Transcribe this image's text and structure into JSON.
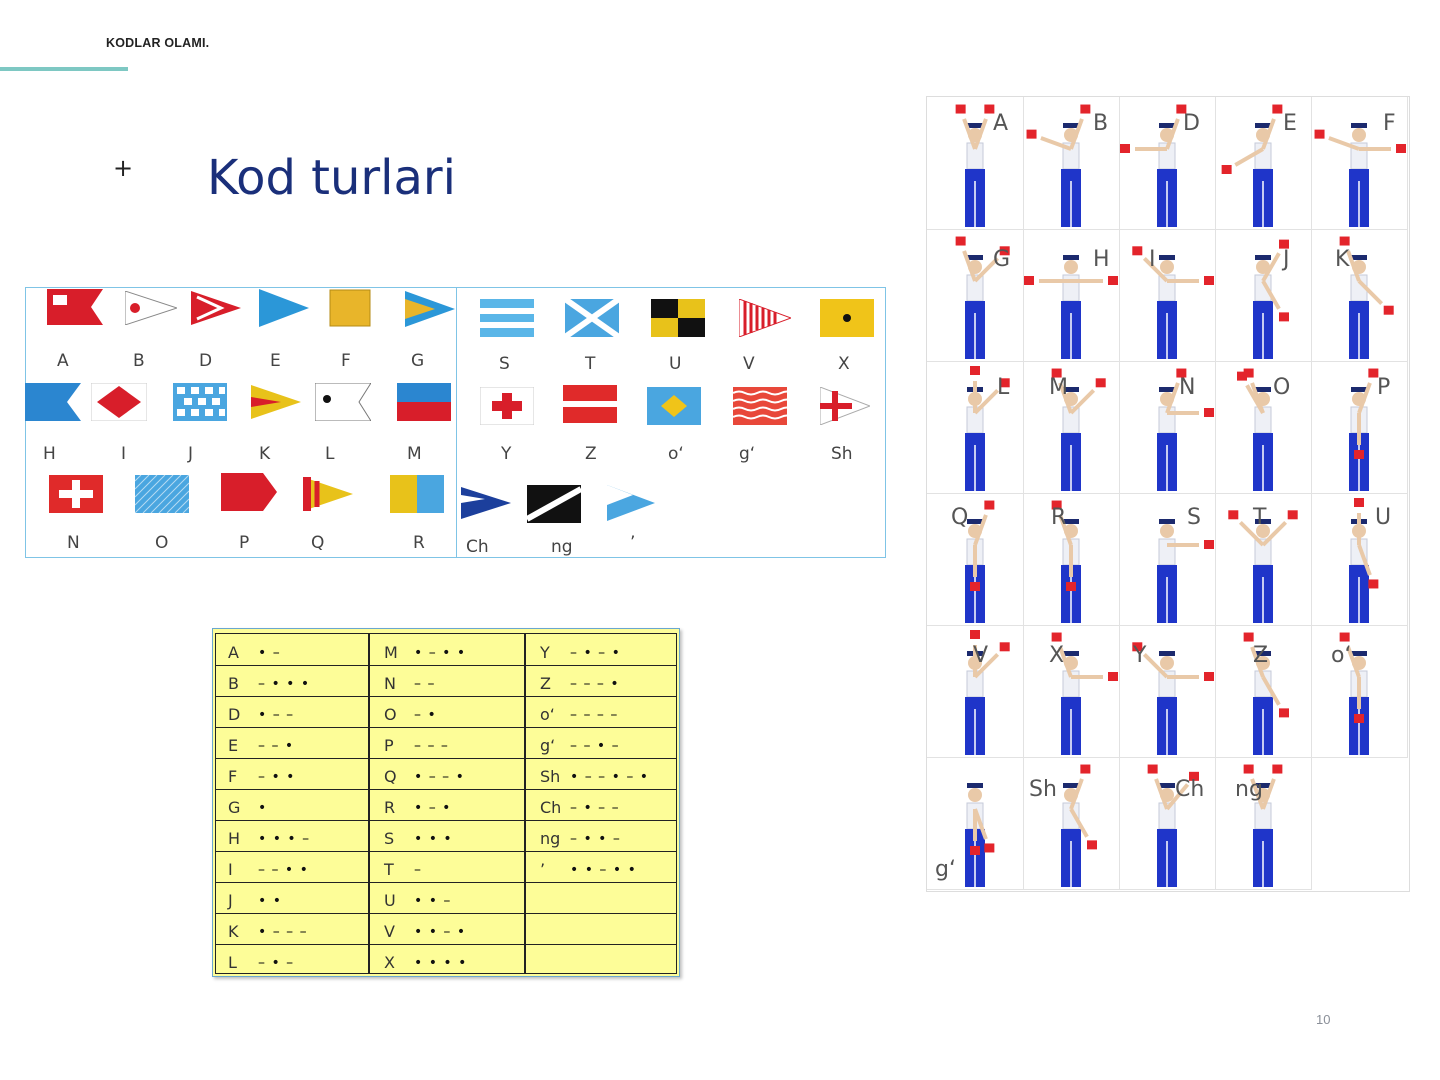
{
  "header": {
    "label": "KODLAR OLAMI."
  },
  "slide": {
    "plus": "+",
    "title": "Kod turlari",
    "page_number": "10"
  },
  "flags": {
    "left": [
      "A",
      "B",
      "D",
      "E",
      "F",
      "G",
      "H",
      "I",
      "J",
      "K",
      "L",
      "M",
      "N",
      "O",
      "P",
      "Q",
      "R"
    ],
    "right": [
      "S",
      "T",
      "U",
      "V",
      "X",
      "Y",
      "Z",
      "o‘",
      "g‘",
      "Sh",
      "Ch",
      "ng",
      "’"
    ]
  },
  "morse": {
    "col1": [
      {
        "letter": "A",
        "code": "• –"
      },
      {
        "letter": "B",
        "code": "– • • •"
      },
      {
        "letter": "D",
        "code": "• – –"
      },
      {
        "letter": "E",
        "code": "– – •"
      },
      {
        "letter": "F",
        "code": "– • •"
      },
      {
        "letter": "G",
        "code": "•"
      },
      {
        "letter": "H",
        "code": "• • • –"
      },
      {
        "letter": "I",
        "code": "– – • •"
      },
      {
        "letter": "J",
        "code": "• •"
      },
      {
        "letter": "K",
        "code": "• – – –"
      },
      {
        "letter": "L",
        "code": "– • –"
      }
    ],
    "col2": [
      {
        "letter": "M",
        "code": "• – • •"
      },
      {
        "letter": "N",
        "code": "– –"
      },
      {
        "letter": "O",
        "code": "– •"
      },
      {
        "letter": "P",
        "code": "– – –"
      },
      {
        "letter": "Q",
        "code": "• – – •"
      },
      {
        "letter": "R",
        "code": "• – •"
      },
      {
        "letter": "S",
        "code": "• • •"
      },
      {
        "letter": "T",
        "code": "–"
      },
      {
        "letter": "U",
        "code": "• • –"
      },
      {
        "letter": "V",
        "code": "• • – •"
      },
      {
        "letter": "X",
        "code": "• • • •"
      }
    ],
    "col3": [
      {
        "letter": "Y",
        "code": "– • – •"
      },
      {
        "letter": "Z",
        "code": "– – – •"
      },
      {
        "letter": "o‘",
        "code": "– – – –"
      },
      {
        "letter": "g‘",
        "code": "– – • –"
      },
      {
        "letter": "Sh",
        "code": "• – – • – •"
      },
      {
        "letter": "Ch",
        "code": "– • – –"
      },
      {
        "letter": "ng",
        "code": "– • • –"
      },
      {
        "letter": "’",
        "code": "• • – • •"
      }
    ]
  },
  "semaphore": {
    "labels": [
      "A",
      "B",
      "D",
      "E",
      "F",
      "G",
      "H",
      "I",
      "J",
      "K",
      "L",
      "M",
      "N",
      "O",
      "P",
      "Q",
      "R",
      "S",
      "T",
      "U",
      "V",
      "X",
      "Y",
      "Z",
      "o‘",
      "g‘",
      "Sh",
      "Ch",
      "ng"
    ]
  },
  "colors": {
    "title": "#1a2f7a",
    "accent": "#7ec8c3",
    "morse_bg": "#fdfd98",
    "flag_red": "#e3242b",
    "sailor_blue": "#1f35c9"
  }
}
